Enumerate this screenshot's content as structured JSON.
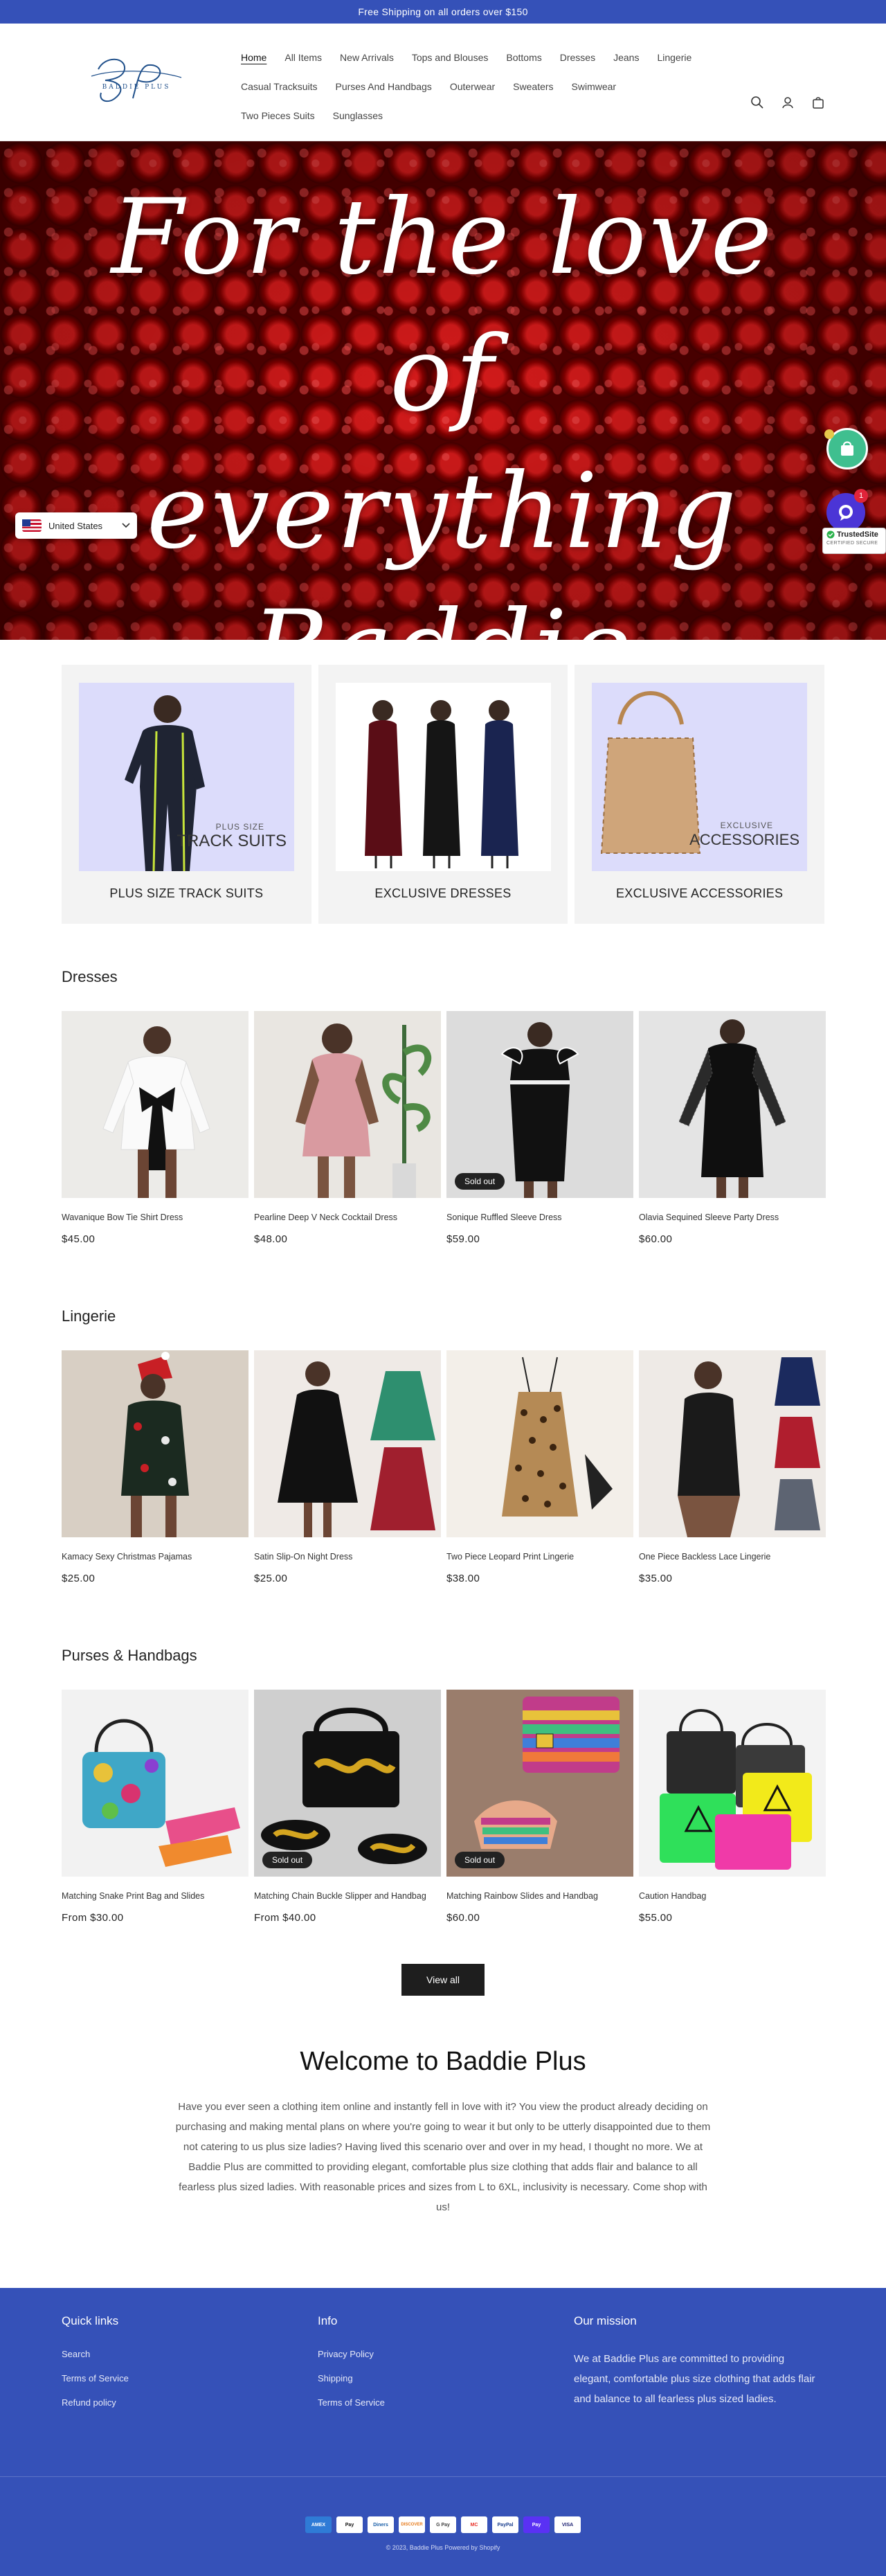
{
  "announcement": "Free Shipping on all orders over $150",
  "logo": {
    "initials": "BP",
    "text": "BADDIE PLUS"
  },
  "nav": {
    "row1": [
      "Home",
      "All Items",
      "New Arrivals",
      "Tops and Blouses",
      "Bottoms",
      "Dresses",
      "Jeans",
      "Lingerie"
    ],
    "row2": [
      "Casual Tracksuits",
      "Purses And Handbags",
      "Outerwear",
      "Sweaters",
      "Swimwear"
    ],
    "row3": [
      "Two Pieces Suits",
      "Sunglasses"
    ]
  },
  "hero": {
    "line1": "For the love of",
    "line2": "everything",
    "line3": "Baddie Plus!!"
  },
  "country_selector": {
    "label": "United States"
  },
  "chat_badge": "1",
  "trusted": {
    "top": "TrustedSite",
    "bottom": "CERTIFIED SECURE"
  },
  "collections": [
    {
      "label": "PLUS SIZE TRACK SUITS",
      "image_caption_small": "PLUS SIZE",
      "image_caption_big": "TRACK SUITS",
      "bg": "#dcdcfb"
    },
    {
      "label": "EXCLUSIVE DRESSES",
      "bg": "#ffffff"
    },
    {
      "label": "EXCLUSIVE ACCESSORIES",
      "image_caption_small": "EXCLUSIVE",
      "image_caption_big": "ACCESSORIES",
      "bg": "#dcdcfb"
    }
  ],
  "sections": [
    {
      "title": "Dresses",
      "products": [
        {
          "name": "Wavanique Bow Tie Shirt Dress",
          "price": "$45.00",
          "sold_out": false
        },
        {
          "name": "Pearline Deep V Neck Cocktail Dress",
          "price": "$48.00",
          "sold_out": false
        },
        {
          "name": "Sonique Ruffled Sleeve Dress",
          "price": "$59.00",
          "sold_out": true
        },
        {
          "name": "Olavia Sequined Sleeve Party Dress",
          "price": "$60.00",
          "sold_out": false
        }
      ]
    },
    {
      "title": "Lingerie",
      "products": [
        {
          "name": "Kamacy Sexy Christmas Pajamas",
          "price": "$25.00",
          "sold_out": false
        },
        {
          "name": "Satin Slip-On Night Dress",
          "price": "$25.00",
          "sold_out": false
        },
        {
          "name": "Two Piece Leopard Print Lingerie",
          "price": "$38.00",
          "sold_out": false
        },
        {
          "name": "One Piece Backless Lace Lingerie",
          "price": "$35.00",
          "sold_out": false
        }
      ]
    },
    {
      "title": "Purses & Handbags",
      "products": [
        {
          "name": "Matching Snake Print Bag and Slides",
          "price": "From $30.00",
          "sold_out": false
        },
        {
          "name": "Matching Chain Buckle Slipper and Handbag",
          "price": "From $40.00",
          "sold_out": true
        },
        {
          "name": "Matching Rainbow Slides and Handbag",
          "price": "$60.00",
          "sold_out": true
        },
        {
          "name": "Caution Handbag",
          "price": "$55.00",
          "sold_out": false
        }
      ]
    }
  ],
  "sold_out_label": "Sold out",
  "view_all": "View all",
  "welcome": {
    "title": "Welcome to Baddie Plus",
    "body": "Have you ever seen a clothing item online and instantly fell in love with it? You view the product already deciding on purchasing and making mental plans on where you're going to wear it but only to be utterly disappointed due to them not catering to us plus size ladies? Having lived this scenario over and over in my head, I thought no more. We at Baddie Plus are committed to providing elegant, comfortable plus size clothing that adds flair and balance to all fearless plus sized ladies. With reasonable prices and sizes from L to 6XL, inclusivity is necessary. Come shop with us!"
  },
  "footer": {
    "quick_links": {
      "title": "Quick links",
      "links": [
        "Search",
        "Terms of Service",
        "Refund policy"
      ]
    },
    "info": {
      "title": "Info",
      "links": [
        "Privacy Policy",
        "Shipping",
        "Terms of Service"
      ]
    },
    "mission": {
      "title": "Our mission",
      "text": "We at Baddie Plus are committed to providing elegant, comfortable plus size clothing that adds flair and balance to all fearless plus sized ladies."
    },
    "payments": [
      "AMEX",
      "Pay",
      "Diners",
      "DISCOVER",
      "G Pay",
      "MC",
      "PayPal",
      "Pay",
      "VISA"
    ],
    "copyright": "© 2023, Baddie Plus Powered by Shopify"
  },
  "colors": {
    "brand_blue": "#3551b8",
    "chat_purple": "#4b35d6",
    "bag_green": "#3fbf8f"
  }
}
